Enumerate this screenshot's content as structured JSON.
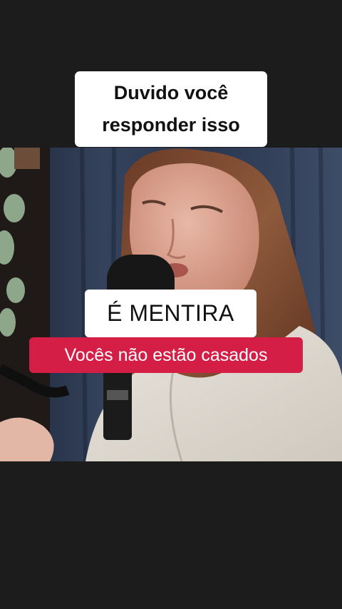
{
  "captions": {
    "top_line1": "Duvido você",
    "top_line2": "responder isso",
    "middle": "É MENTIRA",
    "subtitle": "Vocês não estão casados"
  },
  "colors": {
    "background": "#1c1c1c",
    "caption_bg": "#ffffff",
    "caption_text": "#111111",
    "subtitle_bg": "#d41e46",
    "subtitle_text": "#ffffff"
  }
}
